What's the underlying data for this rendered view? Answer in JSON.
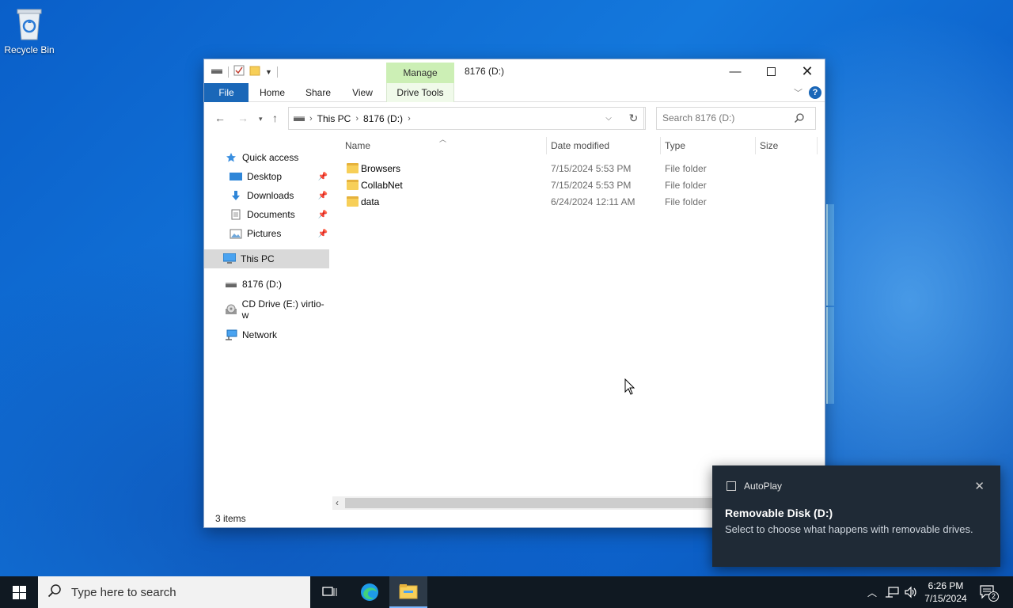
{
  "desktop": {
    "recycle_bin_label": "Recycle Bin"
  },
  "window": {
    "title": "8176 (D:)",
    "contextual_tab_group": "Manage",
    "ribbon_tabs": [
      "File",
      "Home",
      "Share",
      "View",
      "Drive Tools"
    ],
    "help_label": "?",
    "address": {
      "crumbs": [
        "This PC",
        "8176 (D:)"
      ]
    },
    "search_placeholder": "Search 8176 (D:)",
    "nav_pane": {
      "quick_access": "Quick access",
      "items": [
        {
          "label": "Desktop",
          "pinned": true
        },
        {
          "label": "Downloads",
          "pinned": true
        },
        {
          "label": "Documents",
          "pinned": true
        },
        {
          "label": "Pictures",
          "pinned": true
        }
      ],
      "this_pc": "This PC",
      "drive_d": "8176 (D:)",
      "cd_drive": "CD Drive (E:) virtio-w",
      "network": "Network"
    },
    "columns": {
      "name": "Name",
      "date_modified": "Date modified",
      "type": "Type",
      "size": "Size"
    },
    "rows": [
      {
        "name": "Browsers",
        "date": "7/15/2024 5:53 PM",
        "type": "File folder",
        "size": ""
      },
      {
        "name": "CollabNet",
        "date": "7/15/2024 5:53 PM",
        "type": "File folder",
        "size": ""
      },
      {
        "name": "data",
        "date": "6/24/2024 12:11 AM",
        "type": "File folder",
        "size": ""
      }
    ],
    "status": "3 items"
  },
  "toast": {
    "app": "AutoPlay",
    "title": "Removable Disk (D:)",
    "message": "Select to choose what happens with removable drives."
  },
  "taskbar": {
    "search_placeholder": "Type here to search",
    "time": "6:26 PM",
    "date": "7/15/2024",
    "notification_count": "2"
  },
  "colors": {
    "file_tab": "#1a67b8",
    "manage_tab": "#ccefb5",
    "taskbar": "#101922",
    "toast_bg": "#1f2a36"
  }
}
